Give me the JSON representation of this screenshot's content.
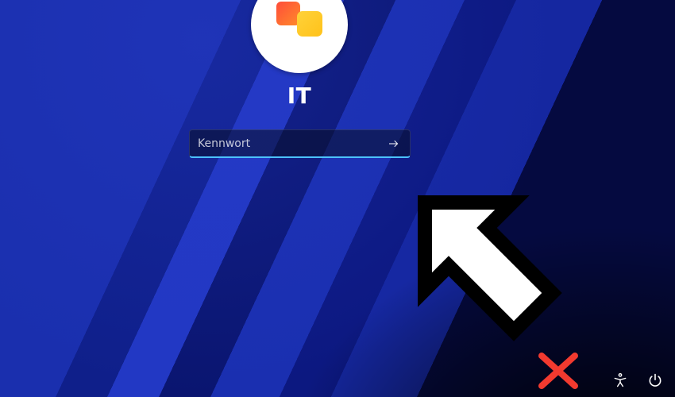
{
  "login": {
    "username": "IT",
    "password_placeholder": "Kennwort",
    "password_value": ""
  },
  "icons": {
    "avatar": "avatar-microsoft-tiles",
    "submit": "arrow-right-icon",
    "accessibility": "accessibility-icon",
    "power": "power-icon"
  },
  "annotations": {
    "arrow": "large-cursor-arrow",
    "x_mark": "red-x-mark"
  },
  "colors": {
    "accent_underline": "#4cc2ff",
    "annotation_red": "#f23a2f",
    "bg_primary": "#0d1e8c"
  }
}
